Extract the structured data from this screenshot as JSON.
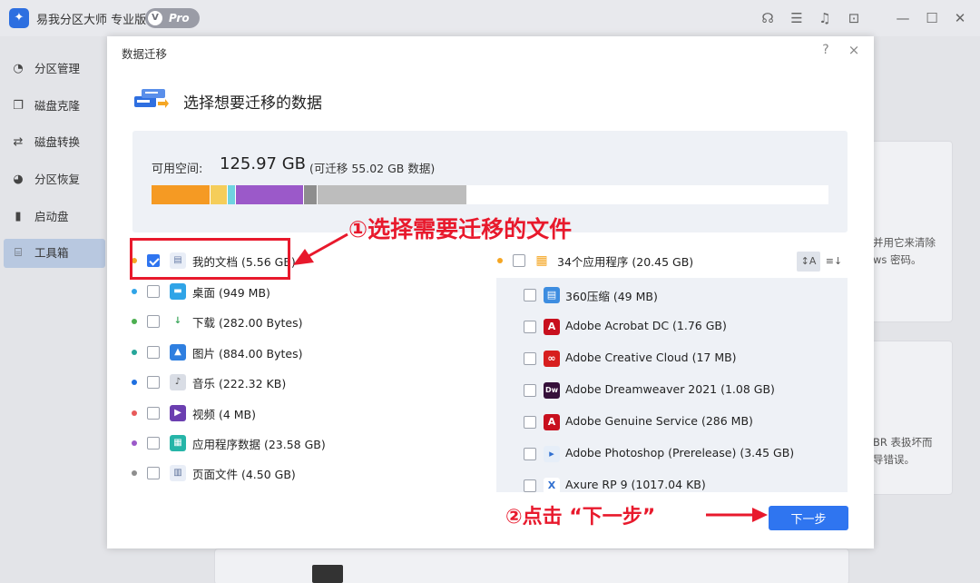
{
  "app": {
    "title": "易我分区大师 专业版",
    "badge": "Pro",
    "badge_v": "V"
  },
  "titlebar_icons": [
    "headset-icon",
    "feedback-icon",
    "bell-icon",
    "download-icon",
    "minimize-icon",
    "maximize-icon",
    "close-icon"
  ],
  "sidebar": {
    "items": [
      {
        "label": "分区管理",
        "icon": "partition-icon"
      },
      {
        "label": "磁盘克隆",
        "icon": "clone-icon"
      },
      {
        "label": "磁盘转换",
        "icon": "convert-icon"
      },
      {
        "label": "分区恢复",
        "icon": "recovery-icon"
      },
      {
        "label": "启动盘",
        "icon": "boot-disk-icon"
      },
      {
        "label": "工具箱",
        "icon": "toolbox-icon"
      }
    ],
    "active_index": 5
  },
  "background": {
    "card1_line1": "并用它来清除",
    "card1_line2": "ws 密码。",
    "card2_line1": "BR 表扱坏而",
    "card2_line2": "导错误。"
  },
  "dialog": {
    "title": "数据迁移",
    "help": "?",
    "close": "×",
    "heading": "选择想要迁移的数据",
    "space_label": "可用空间:",
    "space_value": "125.97 GB",
    "space_note": "(可迁移 55.02 GB 数据)",
    "usage_colors": [
      "#f59a23",
      "#f5cd5a",
      "#6fd3e0",
      "#9b59c9",
      "#8e8e8e",
      "#bdbdbd"
    ],
    "usage_fractions": [
      0.087,
      0.026,
      0.012,
      0.1,
      0.02,
      0.22
    ],
    "folders": [
      {
        "label": "我的文档 (5.56 GB)",
        "checked": true,
        "dot": "#f5a623",
        "icon": "document-icon"
      },
      {
        "label": "桌面 (949 MB)",
        "checked": false,
        "dot": "#2fa4e7",
        "icon": "desktop-icon"
      },
      {
        "label": "下载 (282.00 Bytes)",
        "checked": false,
        "dot": "#4caf50",
        "icon": "download-folder-icon"
      },
      {
        "label": "图片 (884.00 Bytes)",
        "checked": false,
        "dot": "#26a69a",
        "icon": "picture-icon"
      },
      {
        "label": "音乐 (222.32 KB)",
        "checked": false,
        "dot": "#1e6fe0",
        "icon": "music-icon"
      },
      {
        "label": "视频 (4 MB)",
        "checked": false,
        "dot": "#e85a5a",
        "icon": "video-icon"
      },
      {
        "label": "应用程序数据 (23.58 GB)",
        "checked": false,
        "dot": "#9b59c9",
        "icon": "app-data-icon"
      },
      {
        "label": "页面文件 (4.50 GB)",
        "checked": false,
        "dot": "#8e8e8e",
        "icon": "page-file-icon"
      }
    ],
    "apps_header": {
      "label": "34个应用程序 (20.45 GB)",
      "checked": false,
      "dot": "#f5a623",
      "icon": "apps-grid-icon"
    },
    "sort_buttons": [
      "sort-alpha-icon",
      "sort-size-icon"
    ],
    "apps": [
      {
        "label": "360压缩 (49 MB)",
        "icon": "zip-icon",
        "color": "#3d8de0",
        "glyph": "▤"
      },
      {
        "label": "Adobe Acrobat DC (1.76 GB)",
        "icon": "acrobat-icon",
        "color": "#c8101e",
        "glyph": "A"
      },
      {
        "label": "Adobe Creative Cloud (17 MB)",
        "icon": "creative-cloud-icon",
        "color": "#d71e1e",
        "glyph": "∞"
      },
      {
        "label": "Adobe Dreamweaver 2021 (1.08 GB)",
        "icon": "dreamweaver-icon",
        "color": "#35103a",
        "glyph": "Dw"
      },
      {
        "label": "Adobe Genuine Service (286 MB)",
        "icon": "genuine-service-icon",
        "color": "#c8101e",
        "glyph": "A"
      },
      {
        "label": "Adobe Photoshop (Prerelease) (3.45 GB)",
        "icon": "photoshop-icon",
        "color": "#e6eef8",
        "glyph": "▸"
      },
      {
        "label": "Axure RP 9 (1017.04 KB)",
        "icon": "axure-icon",
        "color": "#ffffff",
        "glyph": "X"
      }
    ],
    "next_button": "下一步"
  },
  "annotations": {
    "step1": "①选择需要迁移的文件",
    "step2": "②点击 “下一步”"
  }
}
